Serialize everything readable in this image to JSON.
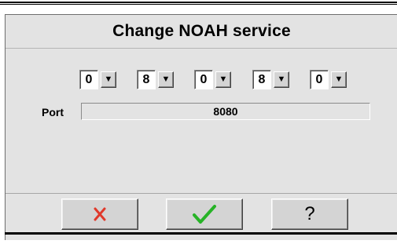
{
  "dialog": {
    "title": "Change NOAH service",
    "digits": [
      "0",
      "8",
      "0",
      "8",
      "0"
    ],
    "port_label": "Port",
    "port_value": "8080"
  },
  "buttons": {
    "cancel_icon": "red-x-icon",
    "ok_icon": "green-check-icon",
    "help_label": "?"
  },
  "colors": {
    "dialog_bg": "#e3e3e3",
    "cancel_x": "#e0392b",
    "ok_check": "#27b327"
  }
}
